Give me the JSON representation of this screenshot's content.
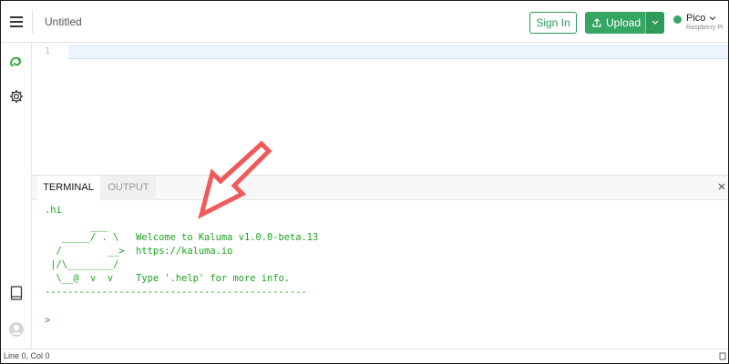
{
  "header": {
    "title": "Untitled",
    "signin_label": "Sign In",
    "upload_label": "Upload",
    "board": {
      "name": "Pico",
      "subtitle": "Raspberry Pi"
    }
  },
  "sidebar": {
    "items": [
      {
        "icon": "kaluma-logo-icon"
      },
      {
        "icon": "gear-icon"
      },
      {
        "icon": "book-icon"
      },
      {
        "icon": "user-avatar-icon"
      }
    ]
  },
  "editor": {
    "line_number": "1"
  },
  "terminal": {
    "tabs": [
      {
        "label": "TERMINAL",
        "active": true
      },
      {
        "label": "OUTPUT",
        "active": false
      }
    ],
    "lines": [
      ".hi",
      "",
      "        ___",
      "   _____/ . \\   Welcome to Kaluma v1.0.0-beta.13",
      "  /        __>  https://kaluma.io",
      " |/\\________/",
      "  \\__@  v  v    Type '.help' for more info.",
      "----------------------------------------------",
      "",
      ">"
    ]
  },
  "status": {
    "text": "Line 0, Col 0"
  },
  "colors": {
    "accent": "#36a763",
    "terminal_text": "#1fa31f",
    "annotation_arrow": "#f05a5a"
  }
}
